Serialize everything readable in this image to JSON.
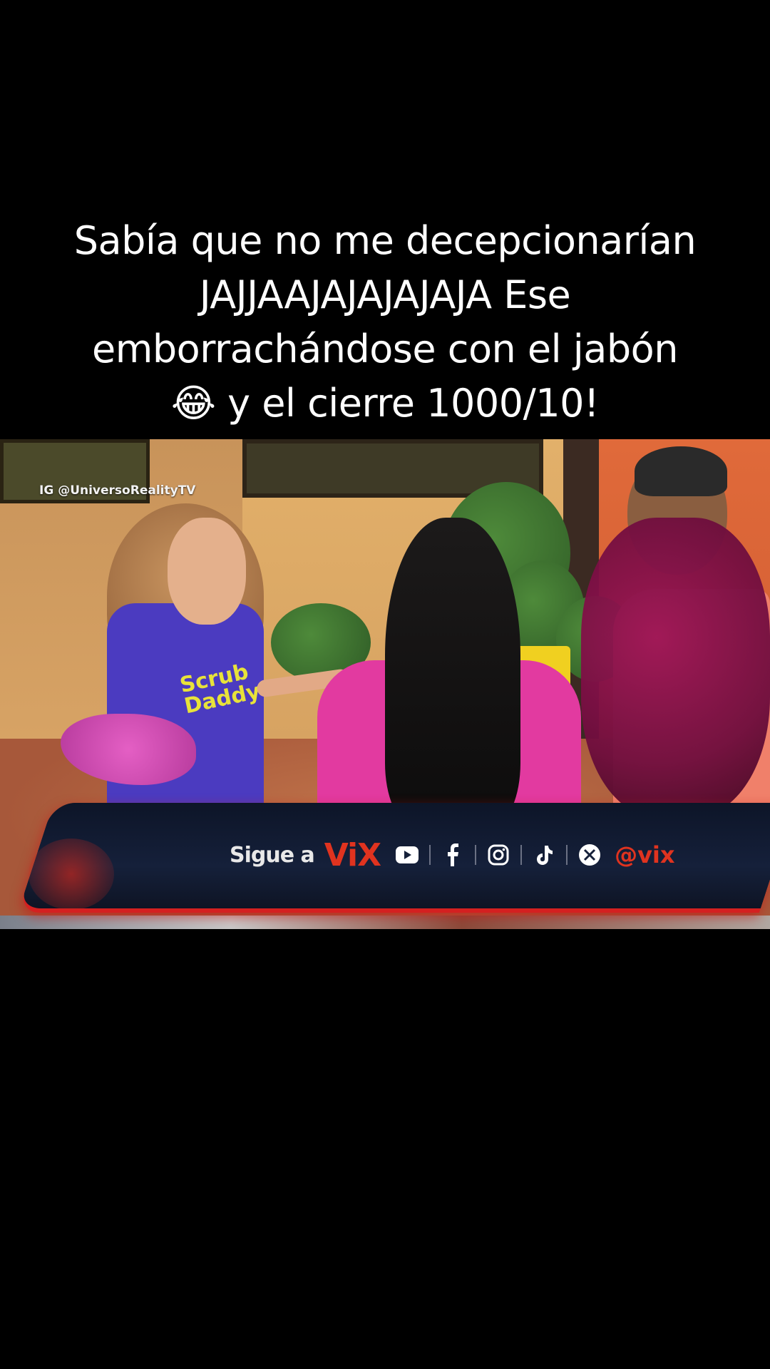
{
  "caption": {
    "line1": "Sabía que no me decepcionarían",
    "line2": "JAJJAAJAJAJAJAJA Ese",
    "line3": "emborrachándose con el jabón",
    "line4": "😂 y el cierre 1000/10!"
  },
  "video": {
    "watermark": "IG @UniversoRealityTV",
    "shirt_logo_line1": "Scrub",
    "shirt_logo_line2": "Daddy",
    "banner": {
      "follow_label": "Sigue a",
      "brand": "ViX",
      "handle": "@vix",
      "icons": [
        "youtube-icon",
        "facebook-icon",
        "instagram-icon",
        "tiktok-icon",
        "x-icon"
      ]
    }
  },
  "colors": {
    "brand_red": "#e0331f",
    "banner_navy": "#15203a"
  }
}
